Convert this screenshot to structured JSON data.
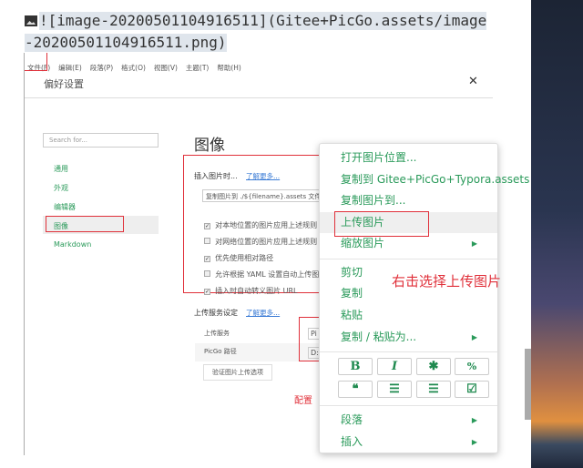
{
  "editor": {
    "line1": "![image-20200501104916511](Gitee+PicGo.assets/image",
    "line2": "-20200501104916511.png)"
  },
  "menubar": [
    "文件(F)",
    "编辑(E)",
    "段落(P)",
    "格式(O)",
    "视图(V)",
    "主题(T)",
    "帮助(H)"
  ],
  "prefs": {
    "title": "偏好设置",
    "close": "✕",
    "search_placeholder": "Search for...",
    "sidebar": [
      "通用",
      "外观",
      "编辑器",
      "图像",
      "Markdown"
    ],
    "heading": "图像",
    "insert_label": "插入图片时...",
    "learn_more": "了解更多...",
    "insert_select": "复制图片到 ./${filename}.assets 文件夹",
    "checks": [
      {
        "label": "对本地位置的图片应用上述规则",
        "checked": true
      },
      {
        "label": "对网络位置的图片应用上述规则",
        "checked": false
      },
      {
        "label": "优先使用相对路径",
        "checked": true
      },
      {
        "label": "允许根据 YAML 设置自动上传图片",
        "checked": false
      },
      {
        "label": "插入时自动转义图片 URL",
        "checked": true
      }
    ],
    "upload_label": "上传服务设定",
    "upload_service": "上传服务",
    "picgo_path": "PicGo 路径",
    "service_value": "Pi",
    "path_value": "D:",
    "verify_button": "验证图片上传选项",
    "config_note": "配置"
  },
  "context_menu": {
    "items1": [
      "打开图片位置...",
      "复制到 Gitee+PicGo+Typora.assets",
      "复制图片到...",
      "上传图片",
      "缩放图片"
    ],
    "items2": [
      "剪切",
      "复制",
      "粘贴",
      "复制 / 粘贴为..."
    ],
    "format_buttons": [
      "B",
      "I",
      "✱",
      "%",
      "❝",
      "☰",
      "☰",
      "☑"
    ],
    "items3": [
      "段落",
      "插入"
    ]
  },
  "annotation": "右击选择上传图片"
}
